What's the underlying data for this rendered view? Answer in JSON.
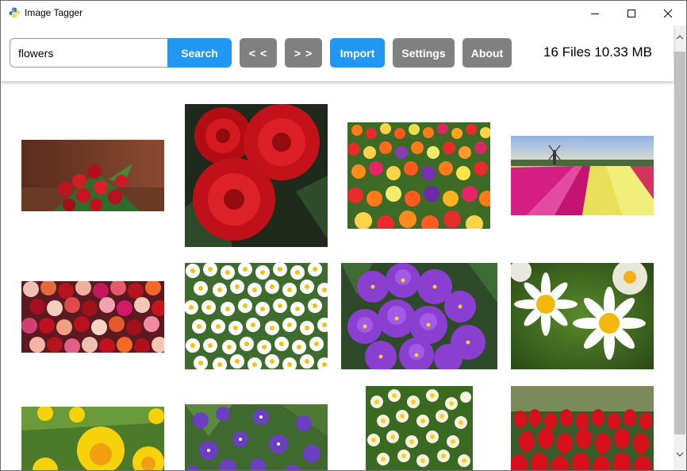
{
  "window": {
    "title": "Image Tagger"
  },
  "toolbar": {
    "search_value": "flowers",
    "search_label": "Search",
    "prev_label": "< <",
    "next_label": "> >",
    "import_label": "Import",
    "settings_label": "Settings",
    "about_label": "About",
    "file_info": "16 Files 10.33 MB"
  },
  "colors": {
    "primary_button": "#2196f3",
    "secondary_button": "#808080"
  },
  "icons": {
    "app": "python-icon",
    "minimize": "minimize-icon",
    "maximize": "maximize-icon",
    "close": "close-icon",
    "scroll_up": "chevron-up-icon",
    "scroll_down": "chevron-down-icon"
  },
  "gallery": {
    "images": [
      {
        "subject": "red-roses-bouquet"
      },
      {
        "subject": "red-roses-closeup"
      },
      {
        "subject": "tulip-field-mixed"
      },
      {
        "subject": "tulip-fields-windmill"
      },
      {
        "subject": "mixed-roses"
      },
      {
        "subject": "white-daisies"
      },
      {
        "subject": "purple-violets"
      },
      {
        "subject": "daisies-two"
      },
      {
        "subject": "yellow-daffodils"
      },
      {
        "subject": "purple-wild-violets"
      },
      {
        "subject": "white-narcissus"
      },
      {
        "subject": "red-tulips"
      }
    ]
  }
}
